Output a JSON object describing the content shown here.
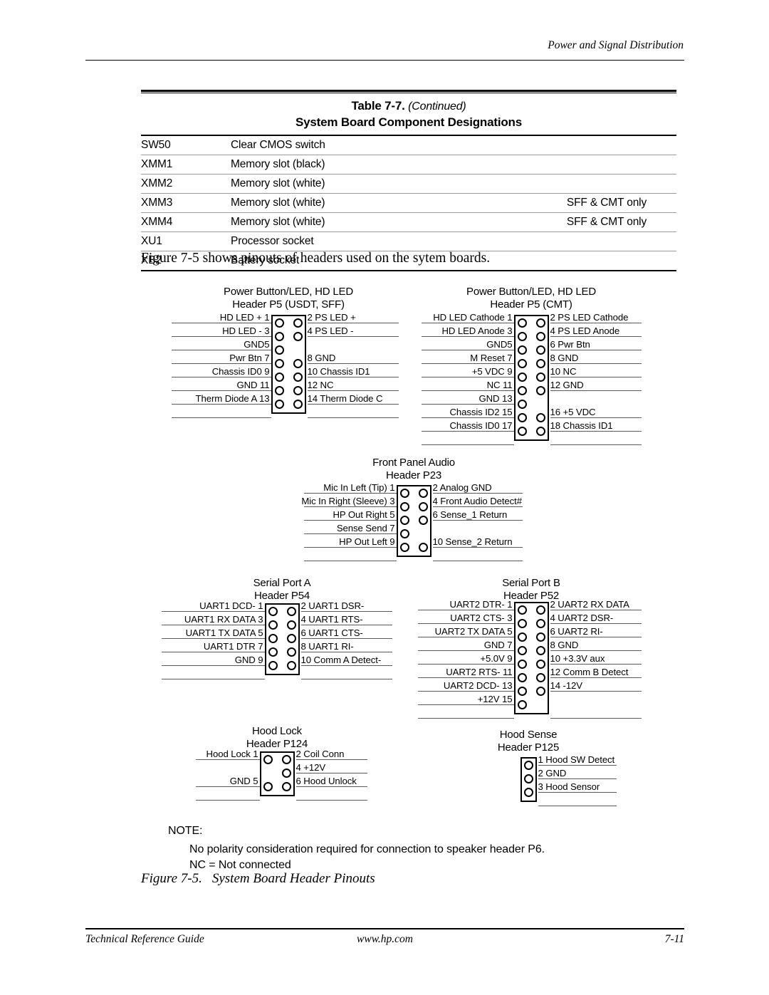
{
  "running_head": "Power and Signal Distribution",
  "table": {
    "title_main": "Table 7-7.",
    "title_continued": "(Continued)",
    "subtitle": "System Board Component Designations",
    "rows": [
      {
        "id": "SW50",
        "desc": "Clear CMOS switch",
        "note": ""
      },
      {
        "id": "XMM1",
        "desc": "Memory slot (black)",
        "note": ""
      },
      {
        "id": "XMM2",
        "desc": "Memory slot (white)",
        "note": ""
      },
      {
        "id": "XMM3",
        "desc": "Memory slot (white)",
        "note": "SFF & CMT only"
      },
      {
        "id": "XMM4",
        "desc": "Memory slot (white)",
        "note": "SFF & CMT only"
      },
      {
        "id": "XU1",
        "desc": "Processor socket",
        "note": ""
      },
      {
        "id": "XB2",
        "desc": "Battery socket",
        "note": ""
      }
    ]
  },
  "intro": "Figure 7-5 shows pinouts of headers used on the sytem boards.",
  "headers": {
    "p5_usdt": {
      "title": "Power Button/LED, HD LED\nHeader P5 (USDT, SFF)",
      "rows": [
        {
          "left": "HD LED + 1",
          "right": "2 PS LED +",
          "left_pin": true,
          "right_pin": true
        },
        {
          "left": "HD LED - 3",
          "right": "4 PS LED -",
          "left_pin": true,
          "right_pin": true
        },
        {
          "left": "GND5",
          "right": "",
          "left_pin": true,
          "right_pin": false
        },
        {
          "left": "Pwr Btn 7",
          "right": "8 GND",
          "left_pin": true,
          "right_pin": true
        },
        {
          "left": "Chassis ID0 9",
          "right": "10 Chassis ID1",
          "left_pin": true,
          "right_pin": true
        },
        {
          "left": "GND 11",
          "right": "12 NC",
          "left_pin": true,
          "right_pin": true
        },
        {
          "left": "Therm Diode A 13",
          "right": "14 Therm Diode C",
          "left_pin": true,
          "right_pin": true
        }
      ]
    },
    "p5_cmt": {
      "title": "Power Button/LED, HD LED\nHeader P5 (CMT)",
      "rows": [
        {
          "left": "HD LED Cathode 1",
          "right": "2 PS LED Cathode",
          "left_pin": true,
          "right_pin": true
        },
        {
          "left": "HD LED Anode 3",
          "right": "4 PS LED Anode",
          "left_pin": true,
          "right_pin": true
        },
        {
          "left": "GND5",
          "right": "6 Pwr Btn",
          "left_pin": true,
          "right_pin": true
        },
        {
          "left": "M Reset 7",
          "right": "8 GND",
          "left_pin": true,
          "right_pin": true
        },
        {
          "left": "+5 VDC 9",
          "right": "10 NC",
          "left_pin": true,
          "right_pin": true
        },
        {
          "left": "NC 11",
          "right": "12 GND",
          "left_pin": true,
          "right_pin": true
        },
        {
          "left": "GND 13",
          "right": "",
          "left_pin": true,
          "right_pin": false
        },
        {
          "left": "Chassis ID2 15",
          "right": "16 +5 VDC",
          "left_pin": true,
          "right_pin": true
        },
        {
          "left": "Chassis ID0 17",
          "right": "18 Chassis ID1",
          "left_pin": true,
          "right_pin": true
        }
      ]
    },
    "p23": {
      "title": "Front Panel Audio\nHeader P23",
      "rows": [
        {
          "left": "Mic In Left (Tip) 1",
          "right": "2 Analog GND",
          "left_pin": true,
          "right_pin": true
        },
        {
          "left": "Mic In Right (Sleeve) 3",
          "right": "4 Front Audio Detect#",
          "left_pin": true,
          "right_pin": true
        },
        {
          "left": "HP Out Right 5",
          "right": "6 Sense_1 Return",
          "left_pin": true,
          "right_pin": true
        },
        {
          "left": "Sense Send 7",
          "right": "",
          "left_pin": true,
          "right_pin": false
        },
        {
          "left": "HP Out Left 9",
          "right": "10 Sense_2 Return",
          "left_pin": true,
          "right_pin": true
        }
      ]
    },
    "p54": {
      "title": "Serial Port A\nHeader P54",
      "rows": [
        {
          "left": "UART1 DCD- 1",
          "right": "2 UART1 DSR-",
          "left_pin": true,
          "right_pin": true
        },
        {
          "left": "UART1 RX DATA 3",
          "right": "4 UART1 RTS-",
          "left_pin": true,
          "right_pin": true
        },
        {
          "left": "UART1 TX DATA 5",
          "right": "6 UART1 CTS-",
          "left_pin": true,
          "right_pin": true
        },
        {
          "left": "UART1 DTR 7",
          "right": "8 UART1 RI-",
          "left_pin": true,
          "right_pin": true
        },
        {
          "left": "GND 9",
          "right": "10 Comm A Detect-",
          "left_pin": true,
          "right_pin": true
        }
      ]
    },
    "p52": {
      "title": "Serial Port B\nHeader P52",
      "rows": [
        {
          "left": "UART2 DTR- 1",
          "right": "2 UART2 RX DATA",
          "left_pin": true,
          "right_pin": true
        },
        {
          "left": "UART2 CTS- 3",
          "right": "4 UART2 DSR-",
          "left_pin": true,
          "right_pin": true
        },
        {
          "left": "UART2 TX DATA 5",
          "right": "6 UART2 RI-",
          "left_pin": true,
          "right_pin": true
        },
        {
          "left": "GND 7",
          "right": "8 GND",
          "left_pin": true,
          "right_pin": true
        },
        {
          "left": "+5.0V 9",
          "right": "10 +3.3V aux",
          "left_pin": true,
          "right_pin": true
        },
        {
          "left": "UART2 RTS- 11",
          "right": "12 Comm B Detect",
          "left_pin": true,
          "right_pin": true
        },
        {
          "left": "UART2 DCD- 13",
          "right": "14 -12V",
          "left_pin": true,
          "right_pin": true
        },
        {
          "left": "+12V 15",
          "right": "",
          "left_pin": true,
          "right_pin": false
        }
      ]
    },
    "p124": {
      "title": "Hood Lock\nHeader P124",
      "rows": [
        {
          "left": "Hood Lock 1",
          "right": "2 Coil Conn",
          "left_pin": true,
          "right_pin": true
        },
        {
          "left": "",
          "right": "4 +12V",
          "left_pin": false,
          "right_pin": true
        },
        {
          "left": "GND 5",
          "right": "6 Hood Unlock",
          "left_pin": true,
          "right_pin": true
        }
      ]
    },
    "p125": {
      "title": "Hood Sense\nHeader P125",
      "rows": [
        {
          "left": "",
          "right": "1 Hood SW Detect",
          "left_pin": true,
          "right_pin": false
        },
        {
          "left": "",
          "right": "2 GND",
          "left_pin": true,
          "right_pin": false
        },
        {
          "left": "",
          "right": "3 Hood Sensor",
          "left_pin": true,
          "right_pin": false
        }
      ]
    }
  },
  "note": {
    "label": "NOTE:",
    "line1": "No polarity consideration required for connection to speaker header P6.",
    "line2": "NC = Not connected"
  },
  "figure_caption": {
    "number": "Figure 7-5.",
    "text": "System Board Header Pinouts"
  },
  "footer": {
    "left": "Technical Reference Guide",
    "center": "www.hp.com",
    "right": "7-11"
  }
}
